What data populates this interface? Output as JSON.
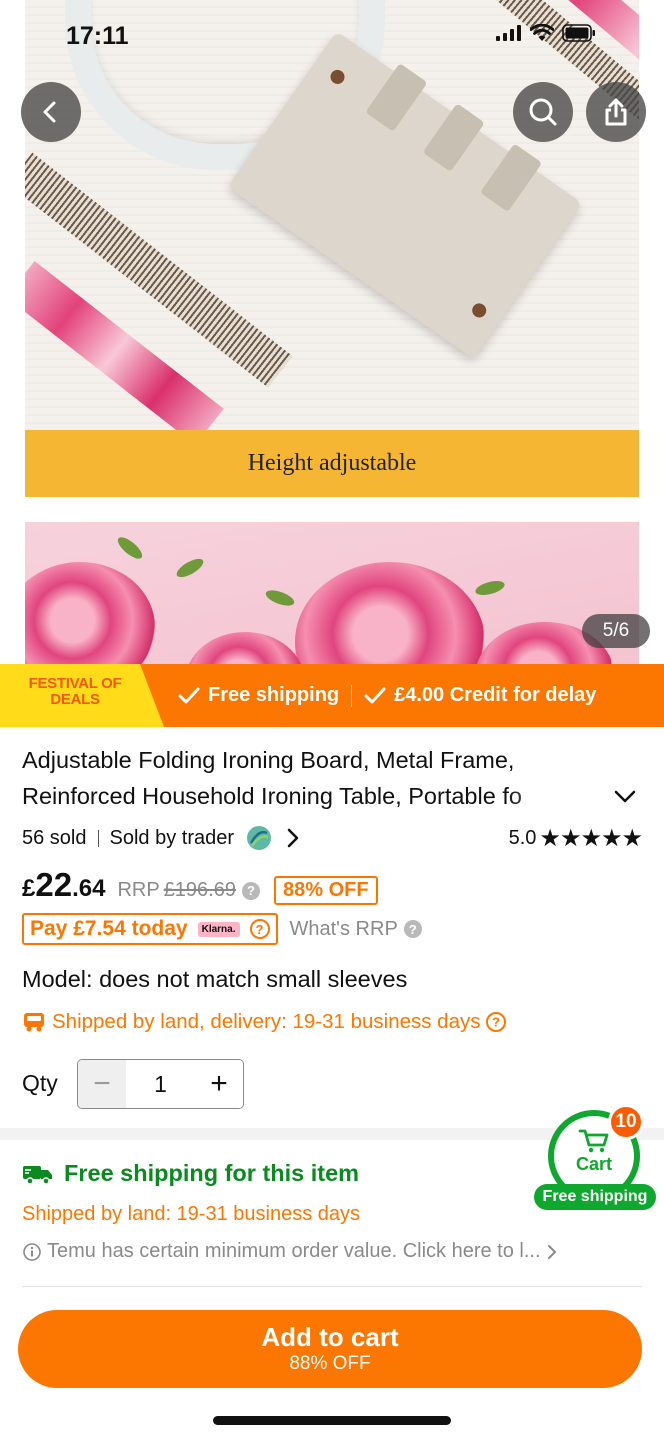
{
  "status_bar": {
    "time": "17:11"
  },
  "gallery": {
    "caption": "Height adjustable",
    "counter": "5/6"
  },
  "promo_banner": {
    "festival_label": "FESTIVAL OF DEALS",
    "free_shipping": "Free shipping",
    "credit_delay": "£4.00 Credit for delay"
  },
  "product": {
    "title_line1": "Adjustable Folding Ironing Board, Metal Frame,",
    "title_line2": "Reinforced Household Ironing Table, Portable fo",
    "sold_count": "56 sold",
    "sold_by": "Sold by trader",
    "rating": "5.0",
    "stars": "★★★★★"
  },
  "price": {
    "currency": "£",
    "whole": "22",
    "decimal": ".64",
    "rrp_label": "RRP",
    "rrp_value": "£196.69",
    "discount": "88% OFF",
    "pay_today": "Pay £7.54 today",
    "klarna": "Klarna.",
    "whats_rrp": "What's RRP"
  },
  "model": "Model: does not match small sleeves",
  "shipping": {
    "by_land": "Shipped by land, delivery: 19-31 business days",
    "free_title": "Free shipping for this item",
    "land_days": "Shipped by land: 19-31 business days",
    "min_order": "Temu has certain minimum order value. Click here to l..."
  },
  "quantity": {
    "label": "Qty",
    "value": "1",
    "minus": "−",
    "plus": "+"
  },
  "cart": {
    "label": "Cart",
    "free_shipping": "Free shipping",
    "count": "10"
  },
  "cta": {
    "label": "Add to cart",
    "sub": "88% OFF"
  },
  "colors": {
    "accent": "#fb7701",
    "green": "#0fa82e",
    "festival_yellow": "#ffdb1a"
  }
}
